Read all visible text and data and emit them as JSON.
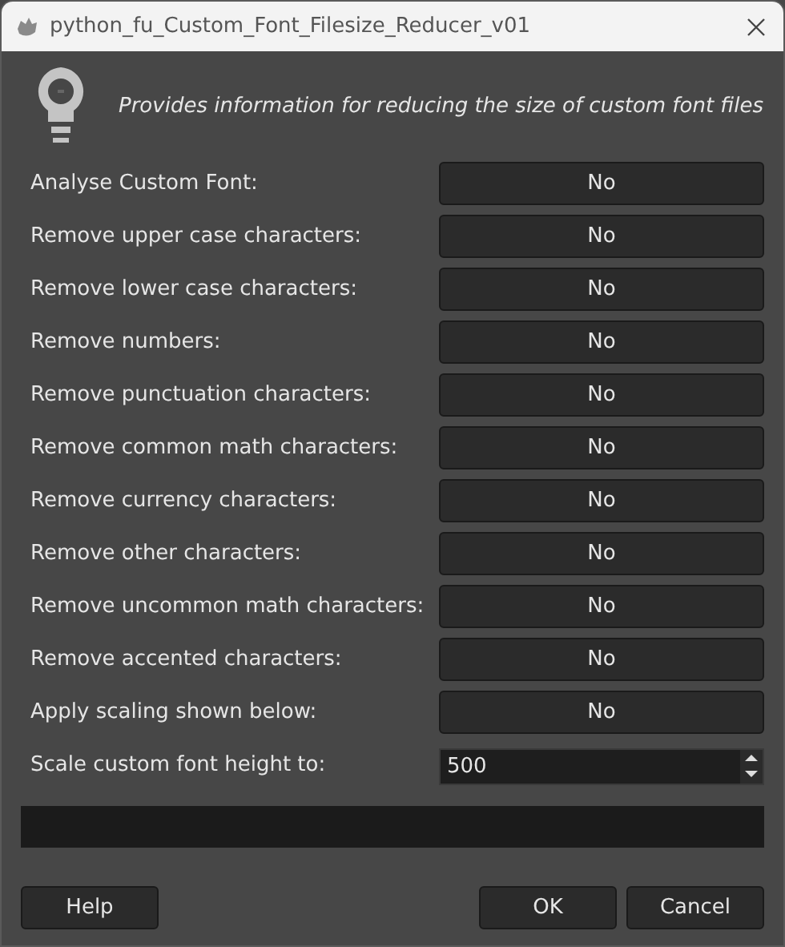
{
  "window": {
    "title": "python_fu_Custom_Font_Filesize_Reducer_v01"
  },
  "header": {
    "description": "Provides information for reducing the size of custom font files"
  },
  "options": [
    {
      "kind": "toggle",
      "label": "Analyse Custom Font:",
      "value": "No"
    },
    {
      "kind": "toggle",
      "label": "Remove upper case characters:",
      "value": "No"
    },
    {
      "kind": "toggle",
      "label": "Remove lower case characters:",
      "value": "No"
    },
    {
      "kind": "toggle",
      "label": "Remove numbers:",
      "value": "No"
    },
    {
      "kind": "toggle",
      "label": "Remove punctuation characters:",
      "value": "No"
    },
    {
      "kind": "toggle",
      "label": "Remove common math characters:",
      "value": "No"
    },
    {
      "kind": "toggle",
      "label": "Remove currency characters:",
      "value": "No"
    },
    {
      "kind": "toggle",
      "label": "Remove other characters:",
      "value": "No"
    },
    {
      "kind": "toggle",
      "label": "Remove uncommon math characters:",
      "value": "No"
    },
    {
      "kind": "toggle",
      "label": "Remove accented characters:",
      "value": "No"
    },
    {
      "kind": "toggle",
      "label": "Apply scaling shown below:",
      "value": "No"
    },
    {
      "kind": "spin",
      "label": "Scale custom font height to:",
      "value": "500"
    }
  ],
  "buttons": [
    "Help",
    "OK",
    "Cancel"
  ]
}
